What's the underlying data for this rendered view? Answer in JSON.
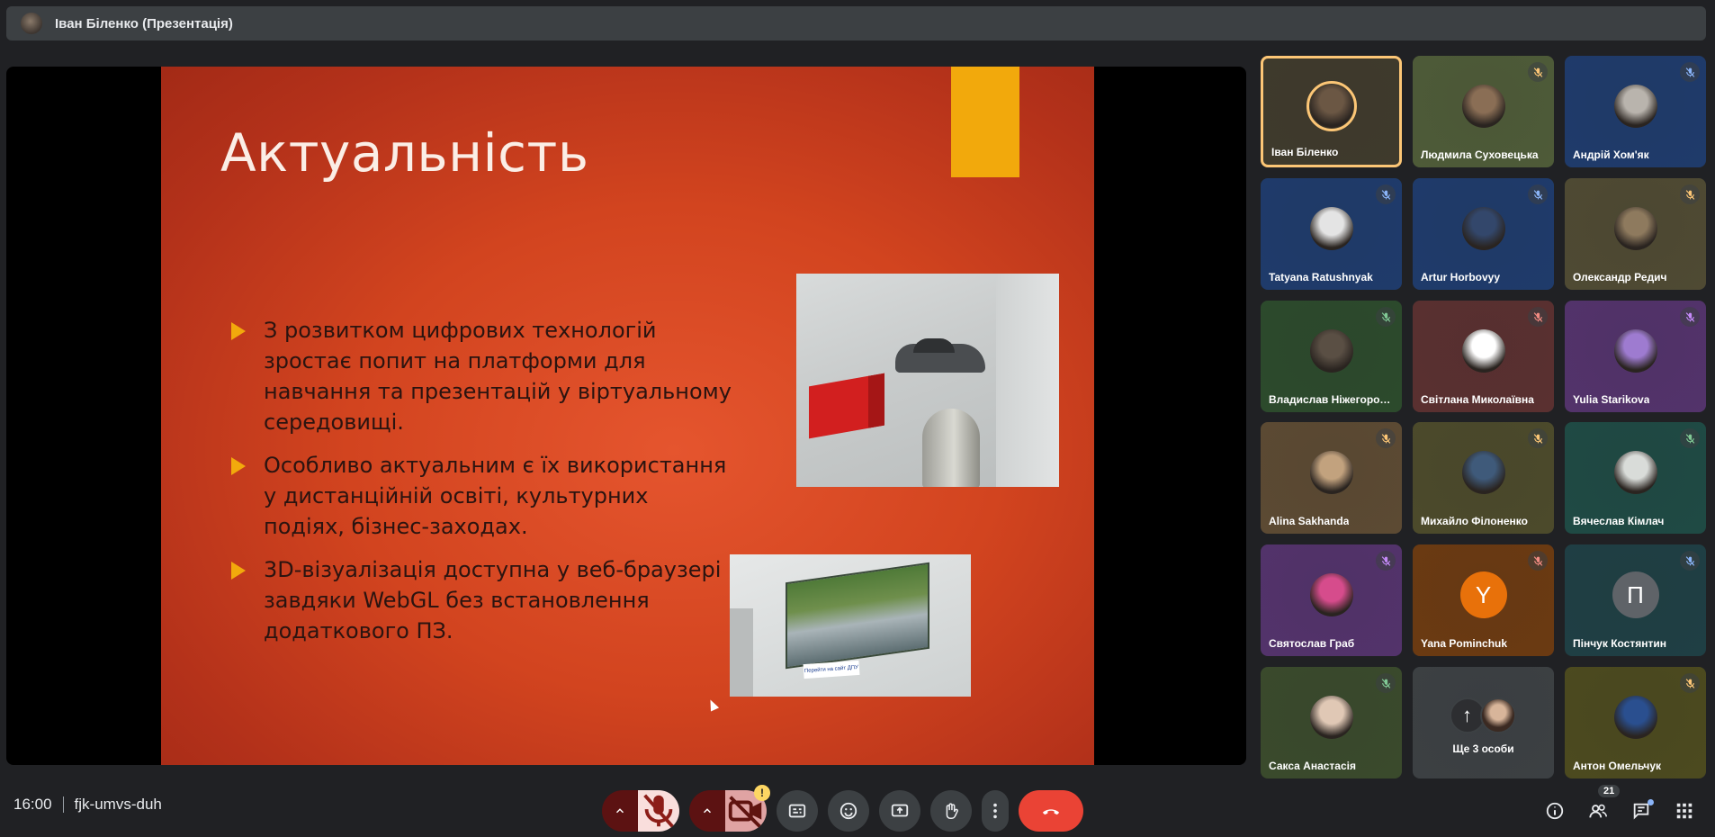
{
  "topbar": {
    "presenter_title": "Іван Біленко (Презентація)"
  },
  "slide": {
    "heading": "Актуальність",
    "bullets": [
      "З розвитком цифрових технологій зростає попит на платформи для навчання та презентацій у віртуальному середовищі.",
      "Особливо актуальним є їх використання у дистанційній освіті, культурних подіях, бізнес-заходах.",
      "3D-візуалізація доступна у веб-браузері завдяки WebGL без встановлення додаткового ПЗ."
    ],
    "image2_label": "Перейти на сайт ДПУ",
    "accent_color": "#f2a90c"
  },
  "participants": [
    {
      "name": "Іван Біленко",
      "bg": "#3f3a2c",
      "mic": "none",
      "active": true,
      "face": "#6b5744"
    },
    {
      "name": "Людмила Суховецька",
      "bg": "#4e5b38",
      "mic": "muted",
      "face": "#8a6e55"
    },
    {
      "name": "Андрій Хом'як",
      "bg": "#1f3b6b",
      "mic": "muted",
      "face": "#b9b4ad"
    },
    {
      "name": "Tatyana Ratushnyak",
      "bg": "#1f3b6b",
      "mic": "muted",
      "face": "#e4e4e4"
    },
    {
      "name": "Artur Horbovyy",
      "bg": "#1f3b6b",
      "mic": "muted",
      "face": "#33476b"
    },
    {
      "name": "Олександр Редич",
      "bg": "#4f4a33",
      "mic": "muted",
      "face": "#8e7a5e"
    },
    {
      "name": "Владислав Ніжегородцев",
      "bg": "#2c4a2c",
      "mic": "muted",
      "face": "#5a4f44"
    },
    {
      "name": "Світлана Миколаївна",
      "bg": "#5a3030",
      "mic": "muted",
      "face": "#ffffff"
    },
    {
      "name": "Yulia Starikova",
      "bg": "#53336b",
      "mic": "muted",
      "face": "#9e7bd0"
    },
    {
      "name": "Alina Sakhanda",
      "bg": "#5c4a33",
      "mic": "muted",
      "face": "#c2a27e"
    },
    {
      "name": "Михайло Філоненко",
      "bg": "#4c4a2b",
      "mic": "muted",
      "face": "#3f5a7a"
    },
    {
      "name": "Вячеслав Кімлач",
      "bg": "#1f4a44",
      "mic": "muted",
      "face": "#d9dcd9"
    },
    {
      "name": "Святослав Граб",
      "bg": "#53336b",
      "mic": "muted",
      "face": "#d64c8c"
    },
    {
      "name": "Yana Pominchuk",
      "bg": "#6b3a12",
      "mic": "muted",
      "letter": "Y",
      "letter_bg": "#e8710a"
    },
    {
      "name": "Пінчук Костянтин",
      "bg": "#1f3f44",
      "mic": "muted",
      "letter": "П",
      "letter_bg": "#5f6368"
    },
    {
      "name": "Сакса Анастасія",
      "bg": "#3a4a2c",
      "mic": "muted",
      "face": "#e0c8b5"
    },
    {
      "name": "Ще 3 особи",
      "bg": "#3c4043",
      "mic": "none",
      "more": true
    },
    {
      "name": "Антон Омельчук",
      "bg": "#4c4a1f",
      "mic": "muted",
      "face": "#2a4f8f"
    }
  ],
  "bottom": {
    "time": "16:00",
    "meeting_code": "fjk-umvs-duh",
    "people_count": "21",
    "camera_warning": "!"
  }
}
